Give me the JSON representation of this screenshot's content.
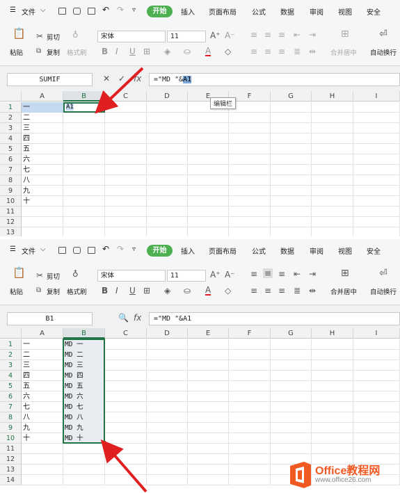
{
  "menu": {
    "file": "文件",
    "start": "开始",
    "tabs": [
      "插入",
      "页面布局",
      "公式",
      "数据",
      "审阅",
      "视图",
      "安全"
    ]
  },
  "ribbon": {
    "cut": "剪切",
    "copy": "复制",
    "paste": "粘贴",
    "format_painter": "格式刷",
    "font_name": "宋体",
    "font_size": "11",
    "merge_center": "合并居中",
    "auto_wrap": "自动换行"
  },
  "screen1": {
    "name_box": "SUMIF",
    "formula_prefix": "=\"MD \"&",
    "formula_ref": "A1",
    "tooltip": "编辑栏",
    "col_headers": [
      "A",
      "B",
      "C",
      "D",
      "E",
      "F",
      "G",
      "H",
      "I"
    ],
    "row_headers": [
      "1",
      "2",
      "3",
      "4",
      "5",
      "6",
      "7",
      "8",
      "9",
      "10",
      "11",
      "12",
      "13"
    ],
    "col_a": [
      "一",
      "二",
      "三",
      "四",
      "五",
      "六",
      "七",
      "八",
      "九",
      "十"
    ],
    "b1_edit": "A1"
  },
  "screen2": {
    "name_box": "B1",
    "formula": "=\"MD \"&A1",
    "col_headers": [
      "A",
      "B",
      "C",
      "D",
      "E",
      "F",
      "G",
      "H",
      "I"
    ],
    "row_headers": [
      "1",
      "2",
      "3",
      "4",
      "5",
      "6",
      "7",
      "8",
      "9",
      "10",
      "11",
      "12",
      "13",
      "14"
    ],
    "col_a": [
      "一",
      "二",
      "三",
      "四",
      "五",
      "六",
      "七",
      "八",
      "九",
      "十"
    ],
    "col_b": [
      "MD 一",
      "MD 二",
      "MD 三",
      "MD 四",
      "MD 五",
      "MD 六",
      "MD 七",
      "MD 八",
      "MD 九",
      "MD 十"
    ]
  },
  "watermark": {
    "brand": "Office教程网",
    "url": "www.office26.com"
  },
  "colors": {
    "accent_green": "#4caf50",
    "selection_green": "#217346",
    "arrow_red": "#e02020",
    "logo_orange": "#f05a22"
  }
}
